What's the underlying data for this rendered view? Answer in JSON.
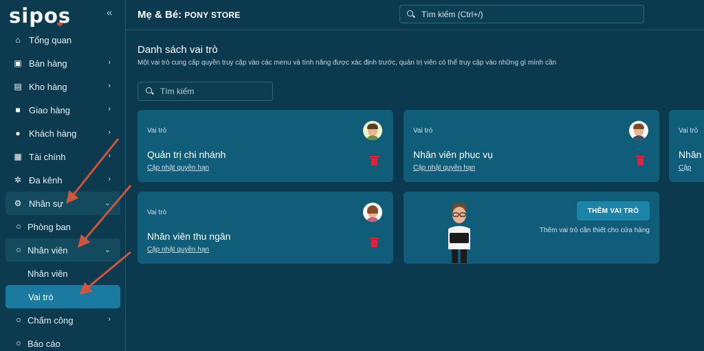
{
  "brand": {
    "logo": "sipos",
    "collapse_icon": "double-chevron-left-icon"
  },
  "sidebar": {
    "items": [
      {
        "label": "Tổng quan",
        "icon": "home-icon"
      },
      {
        "label": "Bán hàng",
        "icon": "cart-icon"
      },
      {
        "label": "Kho hàng",
        "icon": "clipboard-icon"
      },
      {
        "label": "Giao hàng",
        "icon": "truck-icon"
      },
      {
        "label": "Khách hàng",
        "icon": "users-icon"
      },
      {
        "label": "Tài chính",
        "icon": "calculator-icon"
      },
      {
        "label": "Đa kênh",
        "icon": "network-icon"
      },
      {
        "label": "Nhân sự",
        "icon": "user-gear-icon"
      },
      {
        "label": "Phòng ban"
      },
      {
        "label": "Nhân viên"
      },
      {
        "label": "Nhân viên"
      },
      {
        "label": "Vai trò"
      },
      {
        "label": "Chấm công"
      },
      {
        "label": "Báo cáo"
      }
    ]
  },
  "header": {
    "store_prefix": "Mẹ & Bé:",
    "store_name": "PONY STORE",
    "search_placeholder": "Tìm kiếm (Ctrl+/)"
  },
  "main": {
    "title": "Danh sách vai trò",
    "description": "Một vai trò cung cấp quyền truy cập vào các menu và tính năng được xác định trước, quản trị viên có thể truy cập vào những gì mình cần",
    "search_placeholder": "Tìm kiếm",
    "cards": [
      {
        "label": "Vai trò",
        "role": "Quản trị chi nhánh",
        "link": "Cập nhật quyền hạn"
      },
      {
        "label": "Vai trò",
        "role": "Nhân viên phục vụ",
        "link": "Cập nhật quyền hạn"
      },
      {
        "label": "Vai trò",
        "role": "Nhân",
        "link": "Cập"
      },
      {
        "label": "Vai trò",
        "role": "Nhân viên thu ngân",
        "link": "Cập nhật quyền hạn"
      }
    ],
    "add_card": {
      "button": "THÊM VAI TRÒ",
      "description": "Thêm vai trò cần thiết cho cửa hàng"
    }
  },
  "colors": {
    "background": "#0b3a4e",
    "card": "#0f5d78",
    "active": "#1a7aa0",
    "arrow": "#d2553a",
    "trash": "#e0233b"
  }
}
